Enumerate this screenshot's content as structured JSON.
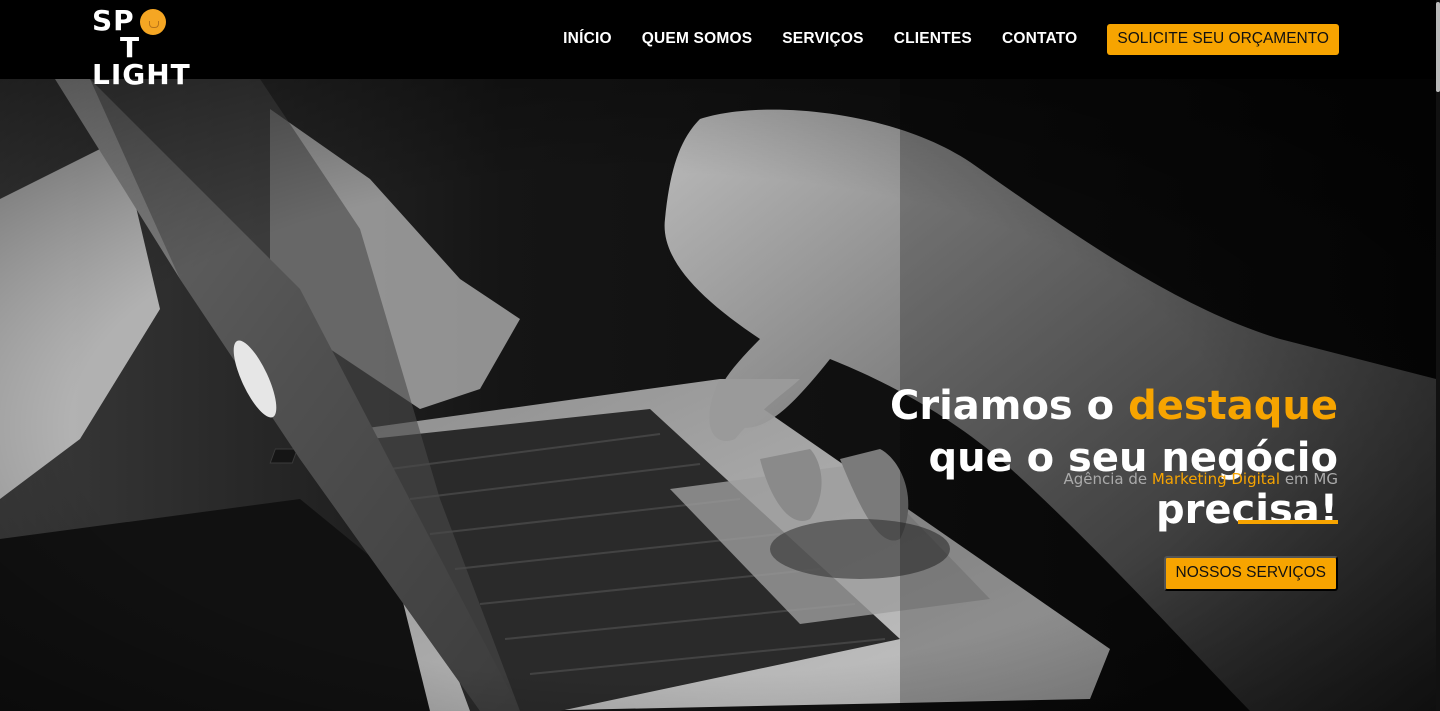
{
  "brand": {
    "line1_a": "SP",
    "line1_b": "T",
    "line2": "LIGHT",
    "accent_color": "#f7a400"
  },
  "nav": {
    "items": [
      {
        "label": "INÍCIO"
      },
      {
        "label": "QUEM SOMOS"
      },
      {
        "label": "SERVIÇOS"
      },
      {
        "label": "CLIENTES"
      },
      {
        "label": "CONTATO"
      }
    ],
    "cta_label": "SOLICITE SEU ORÇAMENTO"
  },
  "hero": {
    "headline_1_pre": "Criamos o ",
    "headline_1_accent": "destaque",
    "headline_2": "que o seu negócio",
    "headline_3": "precisa!",
    "sub_pre": "Agência de ",
    "sub_accent": "Marketing Digital",
    "sub_post": " em MG",
    "button_label": "NOSSOS SERVIÇOS",
    "background_image": "laptop-typing-photo"
  }
}
